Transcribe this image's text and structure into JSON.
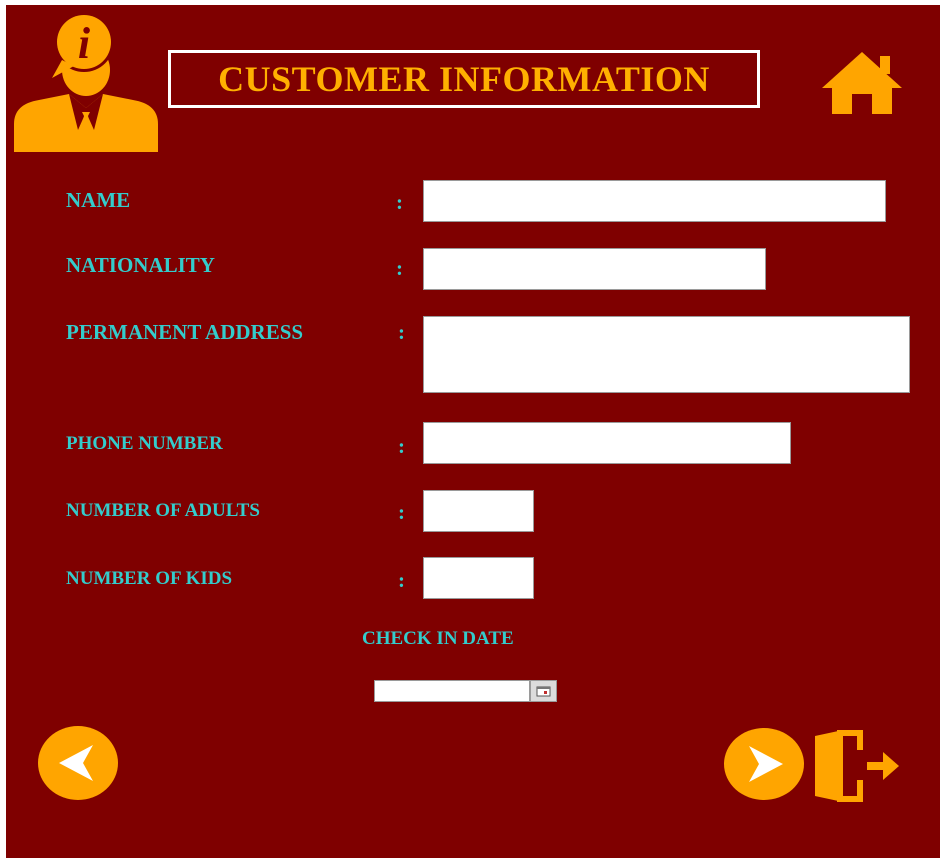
{
  "header": {
    "title": "CUSTOMER INFORMATION"
  },
  "icons": {
    "info_user": "customer-info-icon",
    "home": "home-icon",
    "back": "back-arrow-icon",
    "next": "next-arrow-icon",
    "exit": "exit-door-icon",
    "calendar": "calendar-icon"
  },
  "form": {
    "name": {
      "label": "NAME",
      "value": ""
    },
    "nationality": {
      "label": "NATIONALITY",
      "value": ""
    },
    "permanent_address": {
      "label": "PERMANENT ADDRESS",
      "value": ""
    },
    "phone_number": {
      "label": "PHONE NUMBER",
      "value": ""
    },
    "number_of_adults": {
      "label": "NUMBER OF ADULTS",
      "value": ""
    },
    "number_of_kids": {
      "label": "NUMBER OF KIDS",
      "value": ""
    },
    "separator": ":",
    "check_in_date": {
      "label": "CHECK IN DATE",
      "value": ""
    }
  },
  "colors": {
    "background": "#7f0000",
    "accent": "#ffa500",
    "label": "#33cccc",
    "title_border": "#ffffff"
  }
}
